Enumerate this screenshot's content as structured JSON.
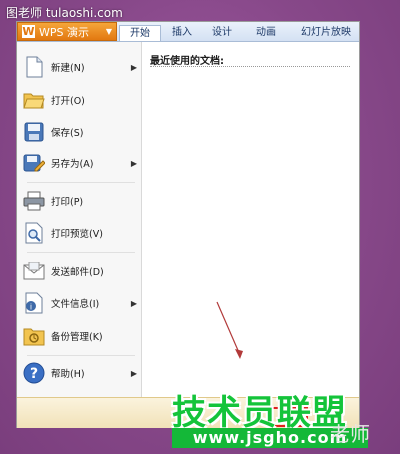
{
  "watermark": {
    "top_left": "图老师 tulaoshi.com",
    "big": "技术员联盟",
    "url": "www.jsgho.com",
    "right": "老师"
  },
  "app_button": {
    "label": "WPS 演示",
    "logo": "W"
  },
  "tabs": [
    {
      "label": "开始"
    },
    {
      "label": "插入"
    },
    {
      "label": "设计"
    },
    {
      "label": "动画"
    },
    {
      "label": "幻灯片放映"
    }
  ],
  "menu": {
    "items": [
      {
        "label": "新建(N)",
        "icon": "new-document-icon",
        "submenu": true
      },
      {
        "label": "打开(O)",
        "icon": "open-folder-icon",
        "submenu": false
      },
      {
        "label": "保存(S)",
        "icon": "save-disk-icon",
        "submenu": false
      },
      {
        "label": "另存为(A)",
        "icon": "save-as-icon",
        "submenu": true
      },
      {
        "label": "打印(P)",
        "icon": "printer-icon",
        "submenu": false
      },
      {
        "label": "打印预览(V)",
        "icon": "print-preview-icon",
        "submenu": false
      },
      {
        "label": "发送邮件(D)",
        "icon": "mail-icon",
        "submenu": false
      },
      {
        "label": "文件信息(I)",
        "icon": "file-info-icon",
        "submenu": true
      },
      {
        "label": "备份管理(K)",
        "icon": "backup-folder-icon",
        "submenu": false
      },
      {
        "label": "帮助(H)",
        "icon": "help-icon",
        "submenu": true
      }
    ]
  },
  "recent": {
    "title": "最近使用的文档:"
  },
  "colors": {
    "accent_orange": "#e27810",
    "annotation_red": "#e02020",
    "watermark_green": "#14c43a",
    "background_purple": "#8a4a8c"
  }
}
